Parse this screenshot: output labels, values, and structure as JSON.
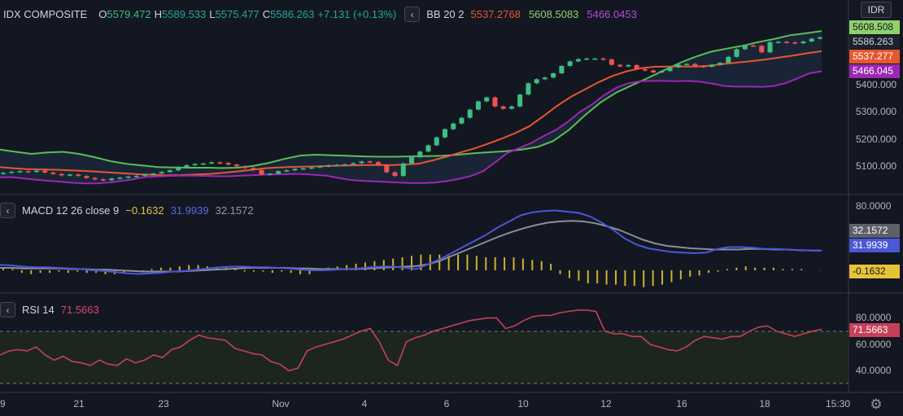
{
  "main_legend": {
    "symbol": "IDX COMPOSITE",
    "open_key": "O",
    "open": "5579.472",
    "high_key": "H",
    "high": "5589.533",
    "low_key": "L",
    "low": "5575.477",
    "close_key": "C",
    "close": "5586.263",
    "change": "+7.131 (+0.13%)"
  },
  "bb_legend": {
    "name": "BB 20 2",
    "basis": "5537.2768",
    "upper": "5608.5083",
    "lower": "5466.0453"
  },
  "macd_legend": {
    "name": "MACD 12 26 close 9",
    "hist": "−0.1632",
    "macd": "31.9939",
    "signal": "32.1572"
  },
  "rsi_legend": {
    "name": "RSI 14",
    "value": "71.5663"
  },
  "currency": "IDR",
  "collapse_glyph": "‹",
  "gear_glyph": "⚙",
  "price_axis": [
    "5400.000",
    "5300.000",
    "5200.000",
    "5100.000"
  ],
  "macd_axis": [
    "80.0000"
  ],
  "rsi_axis": [
    "80.0000",
    "60.0000",
    "40.0000"
  ],
  "price_tags": {
    "upper": "5608.508",
    "close": "5586.263",
    "basis": "5537.277",
    "lower": "5466.045"
  },
  "macd_tags": {
    "signal": "32.1572",
    "macd": "31.9939",
    "hist": "-0.1632"
  },
  "rsi_tag": "71.5663",
  "time_axis": [
    "9",
    "21",
    "23",
    "Nov",
    "4",
    "6",
    "10",
    "12",
    "16",
    "18",
    "15:30"
  ],
  "colors": {
    "up": "#26a69a",
    "down": "#ef5350",
    "bb_basis": "#e6572f",
    "bb_upper": "#5bbd55",
    "bb_lower": "#9c27b0",
    "macd": "#4b57d6",
    "signal": "#8a8e98",
    "hist": "#cfb22d",
    "rsi": "#c5405a"
  },
  "chart_data": {
    "type": "candlestick",
    "close": [
      5108,
      5112,
      5114,
      5111,
      5116,
      5109,
      5104,
      5099,
      5102,
      5097,
      5090,
      5085,
      5082,
      5088,
      5091,
      5095,
      5097,
      5102,
      5106,
      5111,
      5117,
      5129,
      5135,
      5139,
      5141,
      5145,
      5143,
      5137,
      5131,
      5125,
      5118,
      5102,
      5105,
      5114,
      5117,
      5122,
      5124,
      5127,
      5131,
      5134,
      5136,
      5138,
      5142,
      5148,
      5146,
      5135,
      5110,
      5097,
      5141,
      5163,
      5183,
      5205,
      5233,
      5262,
      5282,
      5302,
      5331,
      5360,
      5374,
      5342,
      5334,
      5342,
      5384,
      5424,
      5438,
      5444,
      5459,
      5485,
      5501,
      5509,
      5511,
      5511,
      5508,
      5489,
      5483,
      5488,
      5474,
      5469,
      5462,
      5467,
      5480,
      5490,
      5492,
      5484,
      5482,
      5489,
      5496,
      5517,
      5544,
      5557,
      5556,
      5533,
      5569,
      5570,
      5568,
      5565,
      5571,
      5581,
      5586
    ],
    "bb_upper": [
      5190,
      5182,
      5175,
      5180,
      5182,
      5175,
      5163,
      5149,
      5140,
      5134,
      5128,
      5127,
      5126,
      5126,
      5125,
      5126,
      5132,
      5143,
      5157,
      5169,
      5172,
      5170,
      5168,
      5166,
      5165,
      5165,
      5166,
      5167,
      5168,
      5172,
      5177,
      5181,
      5184,
      5190,
      5199,
      5220,
      5259,
      5310,
      5356,
      5391,
      5417,
      5442,
      5469,
      5495,
      5517,
      5535,
      5546,
      5556,
      5569,
      5580,
      5593,
      5600,
      5608
    ],
    "bb_basis": [
      5128,
      5124,
      5121,
      5120,
      5119,
      5117,
      5115,
      5112,
      5109,
      5106,
      5103,
      5101,
      5099,
      5100,
      5102,
      5104,
      5108,
      5113,
      5118,
      5124,
      5127,
      5129,
      5130,
      5131,
      5133,
      5134,
      5135,
      5136,
      5135,
      5137,
      5140,
      5151,
      5164,
      5179,
      5193,
      5210,
      5228,
      5248,
      5272,
      5307,
      5344,
      5376,
      5402,
      5428,
      5450,
      5466,
      5477,
      5482,
      5483,
      5483,
      5483,
      5486,
      5492,
      5497,
      5502,
      5508,
      5515,
      5522,
      5530,
      5537
    ],
    "bb_lower": [
      5092,
      5093,
      5088,
      5084,
      5080,
      5077,
      5073,
      5071,
      5071,
      5074,
      5079,
      5085,
      5093,
      5095,
      5097,
      5098,
      5098,
      5097,
      5096,
      5096,
      5098,
      5100,
      5102,
      5103,
      5104,
      5104,
      5101,
      5098,
      5090,
      5083,
      5080,
      5078,
      5076,
      5074,
      5072,
      5072,
      5074,
      5079,
      5087,
      5097,
      5114,
      5146,
      5178,
      5196,
      5214,
      5238,
      5259,
      5288,
      5323,
      5349,
      5382,
      5408,
      5424,
      5431,
      5432,
      5432,
      5431,
      5432,
      5429,
      5422,
      5414,
      5412,
      5412,
      5411,
      5414,
      5424,
      5441,
      5459,
      5466
    ],
    "macd": [
      9,
      8,
      6,
      5,
      5,
      4,
      3,
      2,
      0,
      -1,
      -3,
      -5,
      -6,
      -5,
      -4,
      -2,
      -1,
      1,
      3,
      5,
      6,
      6,
      5,
      5,
      4,
      3,
      1,
      0,
      0,
      1,
      2,
      3,
      5,
      6,
      6,
      4,
      2,
      10,
      18,
      28,
      38,
      48,
      58,
      70,
      80,
      90,
      95,
      97,
      98,
      96,
      94,
      88,
      78,
      66,
      52,
      42,
      36,
      33,
      30,
      29,
      28,
      29,
      35,
      38,
      38,
      37,
      35,
      35,
      34,
      33,
      32.5,
      32
    ],
    "signal": [
      4,
      4,
      3,
      3,
      3,
      3,
      2,
      2,
      1,
      1,
      0,
      -1,
      -2,
      -2,
      -2,
      -2,
      -1,
      0,
      1,
      2,
      3,
      4,
      4,
      4,
      4,
      3,
      3,
      2,
      2,
      2,
      2,
      3,
      4,
      5,
      6,
      7,
      10,
      16,
      24,
      32,
      40,
      48,
      56,
      63,
      69,
      74,
      78,
      80,
      81,
      80,
      77,
      72,
      66,
      58,
      50,
      44,
      40,
      38,
      36,
      35,
      34,
      34,
      34,
      35,
      35,
      34,
      34,
      33,
      32.5,
      32.2
    ],
    "hist": [
      2,
      1,
      -2,
      -3,
      -2,
      -2,
      -1,
      -2,
      -1,
      -2,
      -2,
      -3,
      -3,
      -2,
      -1,
      -1,
      1,
      2,
      2,
      3,
      4,
      4,
      3,
      2,
      2,
      1,
      -1,
      -1,
      -1,
      -2,
      -1,
      -2,
      -3,
      -3,
      1,
      2,
      3,
      4,
      5,
      6,
      7,
      8,
      9,
      10,
      11,
      12,
      12,
      12,
      11,
      12,
      12,
      11,
      10,
      10,
      10,
      10,
      9,
      8,
      7,
      5,
      -3,
      -6,
      -8,
      -10,
      -10,
      -11,
      -11,
      -12,
      -12,
      -13,
      -12,
      -11,
      -9,
      -7,
      -5,
      -4,
      -2,
      -1,
      1,
      2,
      3,
      2,
      2,
      2,
      1,
      1,
      1,
      0,
      -0.2
    ],
    "rsi": [
      52,
      55,
      56,
      55,
      58,
      52,
      48,
      51,
      47,
      46,
      44,
      48,
      45,
      44,
      49,
      46,
      48,
      52,
      50,
      56,
      58,
      63,
      67,
      65,
      64,
      63,
      57,
      55,
      53,
      52,
      47,
      45,
      40,
      42,
      55,
      58,
      60,
      62,
      64,
      67,
      70,
      72,
      62,
      48,
      44,
      62,
      65,
      67,
      70,
      72,
      74,
      76,
      78,
      79,
      80,
      80,
      72,
      74,
      78,
      81,
      82,
      82,
      84,
      85,
      86,
      86,
      85,
      70,
      68,
      68,
      66,
      66,
      60,
      58,
      56,
      55,
      58,
      63,
      66,
      65,
      64,
      66,
      66,
      70,
      73,
      74,
      70,
      68,
      66,
      68,
      70,
      71.5
    ],
    "price_range": [
      5040,
      5660
    ],
    "rsi_levels": [
      70,
      30
    ]
  }
}
